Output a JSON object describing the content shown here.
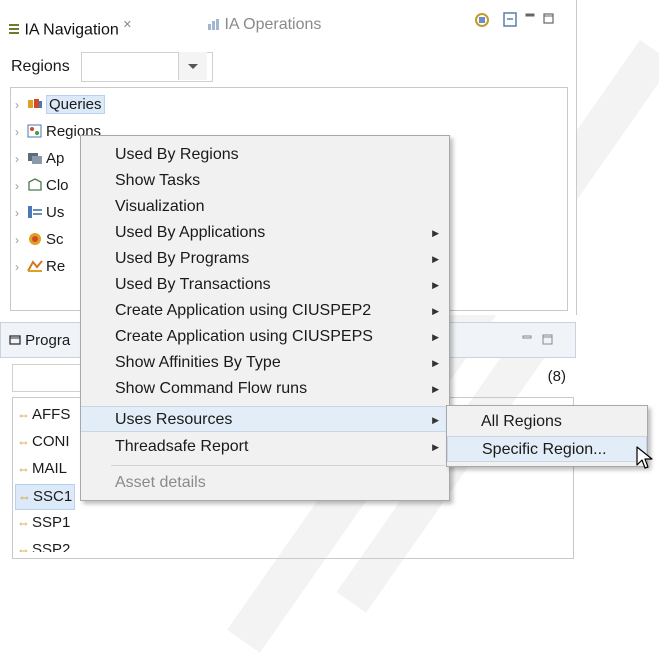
{
  "nav_panel": {
    "tabs": [
      {
        "label": "IA Navigation",
        "close": "✕"
      },
      {
        "label": "IA Operations"
      }
    ],
    "regions_label": "Regions",
    "regions_value": "",
    "tree_items": [
      {
        "label": "Queries",
        "icon": "queries-icon"
      },
      {
        "label": "Regions",
        "icon": "regions-icon"
      },
      {
        "label": "Ap",
        "icon": "applications-icon"
      },
      {
        "label": "Clo",
        "icon": "clock-icon"
      },
      {
        "label": "Us",
        "icon": "users-icon"
      },
      {
        "label": "Sc",
        "icon": "scope-icon"
      },
      {
        "label": "Re",
        "icon": "reports-icon"
      }
    ]
  },
  "programs_panel": {
    "title": "Progra",
    "count": "(8)",
    "items": [
      {
        "label": "AFFS"
      },
      {
        "label": "CONI"
      },
      {
        "label": "MAIL"
      },
      {
        "label": "SSC1"
      },
      {
        "label": "SSP1"
      },
      {
        "label": "SSP2"
      }
    ]
  },
  "context_menu": {
    "items": [
      {
        "label": "Used By Regions",
        "submenu": false
      },
      {
        "label": "Show Tasks",
        "submenu": false
      },
      {
        "label": "Visualization",
        "submenu": false
      },
      {
        "label": "Used By Applications",
        "submenu": true
      },
      {
        "label": "Used By Programs",
        "submenu": true
      },
      {
        "label": "Used By Transactions",
        "submenu": true
      },
      {
        "label": "Create Application using CIUSPEP2",
        "submenu": true
      },
      {
        "label": "Create Application using CIUSPEPS",
        "submenu": true
      },
      {
        "label": "Show Affinities By Type",
        "submenu": true
      },
      {
        "label": "Show Command Flow runs",
        "submenu": true
      },
      {
        "label": "Uses Resources",
        "submenu": true
      },
      {
        "label": "Threadsafe Report",
        "submenu": true
      },
      {
        "label": "Asset details",
        "submenu": false
      }
    ],
    "submenu_arrow": "▶"
  },
  "submenu": {
    "items": [
      {
        "label": "All Regions"
      },
      {
        "label": "Specific Region..."
      }
    ]
  },
  "colors": {
    "highlight": "#e3edf7",
    "menu_bg": "#f1f1f1",
    "disabled_text": "#8a8a8a"
  }
}
